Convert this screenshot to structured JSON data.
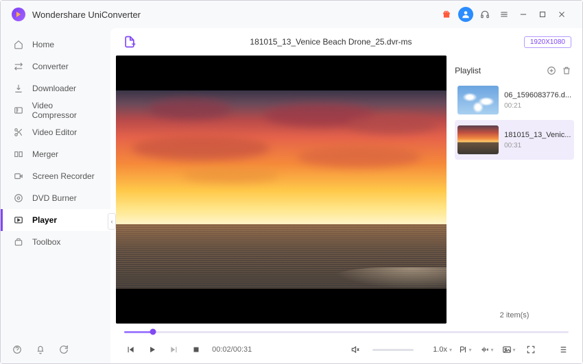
{
  "app": {
    "title": "Wondershare UniConverter"
  },
  "sidebar": {
    "items": [
      {
        "label": "Home"
      },
      {
        "label": "Converter"
      },
      {
        "label": "Downloader"
      },
      {
        "label": "Video Compressor"
      },
      {
        "label": "Video Editor"
      },
      {
        "label": "Merger"
      },
      {
        "label": "Screen Recorder"
      },
      {
        "label": "DVD Burner"
      },
      {
        "label": "Player"
      },
      {
        "label": "Toolbox"
      }
    ],
    "active_index": 8
  },
  "player": {
    "current_file": "181015_13_Venice Beach Drone_25.dvr-ms",
    "resolution_badge": "1920X1080",
    "timecode": "00:02/00:31",
    "speed": "1.0x"
  },
  "playlist": {
    "title": "Playlist",
    "items": [
      {
        "name": "06_1596083776.d...",
        "duration": "00:21"
      },
      {
        "name": "181015_13_Venic...",
        "duration": "00:31"
      }
    ],
    "active_index": 1,
    "count_label": "2 item(s)"
  }
}
